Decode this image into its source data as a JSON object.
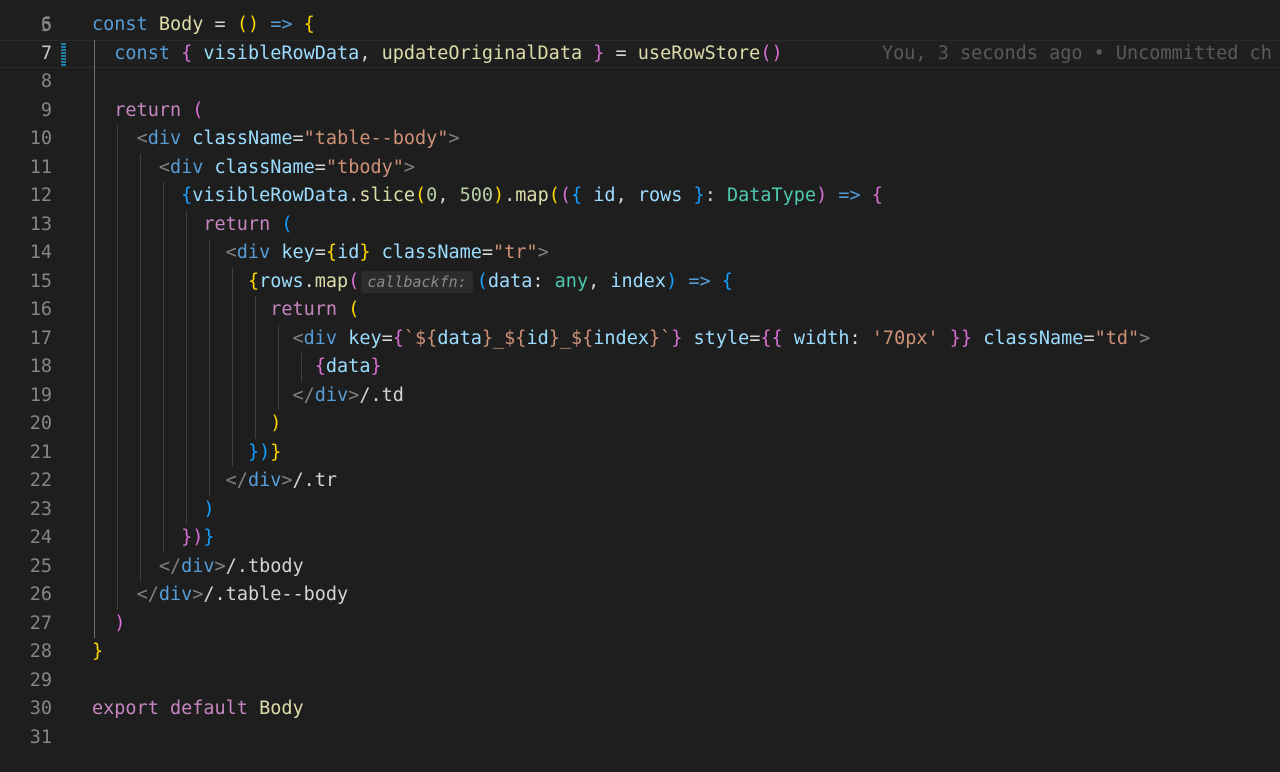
{
  "editor": {
    "language": "tsx",
    "current_line": 7,
    "blame": "You, 3 seconds ago • Uncommitted ch",
    "gutter_top": "5",
    "lines": [
      {
        "n": "6",
        "tokens": [
          [
            "const",
            "kw"
          ],
          [
            " ",
            "txt"
          ],
          [
            "Body",
            "fn"
          ],
          [
            " = ",
            "pun"
          ],
          [
            "()",
            "br1"
          ],
          [
            " ",
            "txt"
          ],
          [
            "=>",
            "kw"
          ],
          [
            " ",
            "txt"
          ],
          [
            "{",
            "br1"
          ]
        ]
      },
      {
        "n": "7",
        "tokens": [
          [
            "  const",
            "kw"
          ],
          [
            " ",
            "txt"
          ],
          [
            "{",
            "br2"
          ],
          [
            " ",
            "txt"
          ],
          [
            "visibleRowData",
            "var"
          ],
          [
            ", ",
            "pun"
          ],
          [
            "updateOriginalData",
            "fn"
          ],
          [
            " ",
            "txt"
          ],
          [
            "}",
            "br2"
          ],
          [
            " = ",
            "pun"
          ],
          [
            "useRowStore",
            "fn"
          ],
          [
            "()",
            "br2"
          ]
        ]
      },
      {
        "n": "8",
        "tokens": []
      },
      {
        "n": "9",
        "tokens": [
          [
            "  return",
            "ctl"
          ],
          [
            " ",
            "txt"
          ],
          [
            "(",
            "br2"
          ]
        ]
      },
      {
        "n": "10",
        "tokens": [
          [
            "    ",
            "txt"
          ],
          [
            "<",
            "ang"
          ],
          [
            "div",
            "tag"
          ],
          [
            " ",
            "txt"
          ],
          [
            "className",
            "var"
          ],
          [
            "=",
            "pun"
          ],
          [
            "\"table--body\"",
            "str"
          ],
          [
            ">",
            "ang"
          ]
        ]
      },
      {
        "n": "11",
        "tokens": [
          [
            "      ",
            "txt"
          ],
          [
            "<",
            "ang"
          ],
          [
            "div",
            "tag"
          ],
          [
            " ",
            "txt"
          ],
          [
            "className",
            "var"
          ],
          [
            "=",
            "pun"
          ],
          [
            "\"tbody\"",
            "str"
          ],
          [
            ">",
            "ang"
          ]
        ]
      },
      {
        "n": "12",
        "tokens": [
          [
            "        ",
            "txt"
          ],
          [
            "{",
            "br3"
          ],
          [
            "visibleRowData",
            "var"
          ],
          [
            ".",
            "pun"
          ],
          [
            "slice",
            "fn"
          ],
          [
            "(",
            "br1"
          ],
          [
            "0",
            "num"
          ],
          [
            ", ",
            "pun"
          ],
          [
            "500",
            "num"
          ],
          [
            ")",
            "br1"
          ],
          [
            ".",
            "pun"
          ],
          [
            "map",
            "fn"
          ],
          [
            "(",
            "br1"
          ],
          [
            "(",
            "br2"
          ],
          [
            "{",
            "br3"
          ],
          [
            " ",
            "txt"
          ],
          [
            "id",
            "var"
          ],
          [
            ", ",
            "pun"
          ],
          [
            "rows",
            "var"
          ],
          [
            " ",
            "txt"
          ],
          [
            "}",
            "br3"
          ],
          [
            ": ",
            "pun"
          ],
          [
            "DataType",
            "typ"
          ],
          [
            ")",
            "br2"
          ],
          [
            " ",
            "txt"
          ],
          [
            "=>",
            "kw"
          ],
          [
            " ",
            "txt"
          ],
          [
            "{",
            "br2"
          ]
        ]
      },
      {
        "n": "13",
        "tokens": [
          [
            "          return",
            "ctl"
          ],
          [
            " ",
            "txt"
          ],
          [
            "(",
            "br3"
          ]
        ]
      },
      {
        "n": "14",
        "tokens": [
          [
            "            ",
            "txt"
          ],
          [
            "<",
            "ang"
          ],
          [
            "div",
            "tag"
          ],
          [
            " ",
            "txt"
          ],
          [
            "key",
            "var"
          ],
          [
            "=",
            "pun"
          ],
          [
            "{",
            "br1"
          ],
          [
            "id",
            "var"
          ],
          [
            "}",
            "br1"
          ],
          [
            " ",
            "txt"
          ],
          [
            "className",
            "var"
          ],
          [
            "=",
            "pun"
          ],
          [
            "\"tr\"",
            "str"
          ],
          [
            ">",
            "ang"
          ]
        ]
      },
      {
        "n": "15",
        "tokens": [
          [
            "              ",
            "txt"
          ],
          [
            "{",
            "br1"
          ],
          [
            "rows",
            "var"
          ],
          [
            ".",
            "pun"
          ],
          [
            "map",
            "fn"
          ],
          [
            "(",
            "br2"
          ],
          [
            "callbackfn:",
            "hint"
          ],
          [
            "(",
            "br3"
          ],
          [
            "data",
            "var"
          ],
          [
            ": ",
            "pun"
          ],
          [
            "any",
            "typ"
          ],
          [
            ", ",
            "pun"
          ],
          [
            "index",
            "var"
          ],
          [
            ")",
            "br3"
          ],
          [
            " ",
            "txt"
          ],
          [
            "=>",
            "kw"
          ],
          [
            " ",
            "txt"
          ],
          [
            "{",
            "br3"
          ]
        ]
      },
      {
        "n": "16",
        "tokens": [
          [
            "                return",
            "ctl"
          ],
          [
            " ",
            "txt"
          ],
          [
            "(",
            "br1"
          ]
        ]
      },
      {
        "n": "17",
        "tokens": [
          [
            "                  ",
            "txt"
          ],
          [
            "<",
            "ang"
          ],
          [
            "div",
            "tag"
          ],
          [
            " ",
            "txt"
          ],
          [
            "key",
            "var"
          ],
          [
            "=",
            "pun"
          ],
          [
            "{",
            "br2"
          ],
          [
            "`${",
            "str"
          ],
          [
            "data",
            "var"
          ],
          [
            "}_${",
            "str"
          ],
          [
            "id",
            "var"
          ],
          [
            "}_${",
            "str"
          ],
          [
            "index",
            "var"
          ],
          [
            "}`",
            "str"
          ],
          [
            "}",
            "br2"
          ],
          [
            " ",
            "txt"
          ],
          [
            "style",
            "var"
          ],
          [
            "=",
            "pun"
          ],
          [
            "{{",
            "br2"
          ],
          [
            " ",
            "txt"
          ],
          [
            "width",
            "var"
          ],
          [
            ": ",
            "pun"
          ],
          [
            "'70px'",
            "str"
          ],
          [
            " ",
            "txt"
          ],
          [
            "}}",
            "br2"
          ],
          [
            " ",
            "txt"
          ],
          [
            "className",
            "var"
          ],
          [
            "=",
            "pun"
          ],
          [
            "\"td\"",
            "str"
          ],
          [
            ">",
            "ang"
          ]
        ]
      },
      {
        "n": "18",
        "tokens": [
          [
            "                    ",
            "txt"
          ],
          [
            "{",
            "br2"
          ],
          [
            "data",
            "var"
          ],
          [
            "}",
            "br2"
          ]
        ]
      },
      {
        "n": "19",
        "tokens": [
          [
            "                  ",
            "txt"
          ],
          [
            "</",
            "ang"
          ],
          [
            "div",
            "tag"
          ],
          [
            ">",
            "ang"
          ],
          [
            "/.td",
            "txt"
          ]
        ]
      },
      {
        "n": "20",
        "tokens": [
          [
            "                ",
            "txt"
          ],
          [
            ")",
            "br1"
          ]
        ]
      },
      {
        "n": "21",
        "tokens": [
          [
            "              ",
            "txt"
          ],
          [
            "})",
            "br3"
          ],
          [
            "}",
            "br1"
          ]
        ]
      },
      {
        "n": "22",
        "tokens": [
          [
            "            ",
            "txt"
          ],
          [
            "</",
            "ang"
          ],
          [
            "div",
            "tag"
          ],
          [
            ">",
            "ang"
          ],
          [
            "/.tr",
            "txt"
          ]
        ]
      },
      {
        "n": "23",
        "tokens": [
          [
            "          ",
            "txt"
          ],
          [
            ")",
            "br3"
          ]
        ]
      },
      {
        "n": "24",
        "tokens": [
          [
            "        ",
            "txt"
          ],
          [
            "})",
            "br2"
          ],
          [
            "}",
            "br3"
          ]
        ]
      },
      {
        "n": "25",
        "tokens": [
          [
            "      ",
            "txt"
          ],
          [
            "</",
            "ang"
          ],
          [
            "div",
            "tag"
          ],
          [
            ">",
            "ang"
          ],
          [
            "/.tbody",
            "txt"
          ]
        ]
      },
      {
        "n": "26",
        "tokens": [
          [
            "    ",
            "txt"
          ],
          [
            "</",
            "ang"
          ],
          [
            "div",
            "tag"
          ],
          [
            ">",
            "ang"
          ],
          [
            "/.table--body",
            "txt"
          ]
        ]
      },
      {
        "n": "27",
        "tokens": [
          [
            "  ",
            "txt"
          ],
          [
            ")",
            "br2"
          ]
        ]
      },
      {
        "n": "28",
        "tokens": [
          [
            "}",
            "br1"
          ]
        ]
      },
      {
        "n": "29",
        "tokens": []
      },
      {
        "n": "30",
        "tokens": [
          [
            "export",
            "ctl"
          ],
          [
            " ",
            "txt"
          ],
          [
            "default",
            "ctl"
          ],
          [
            " ",
            "txt"
          ],
          [
            "Body",
            "fn"
          ]
        ]
      },
      {
        "n": "31",
        "tokens": []
      }
    ]
  }
}
